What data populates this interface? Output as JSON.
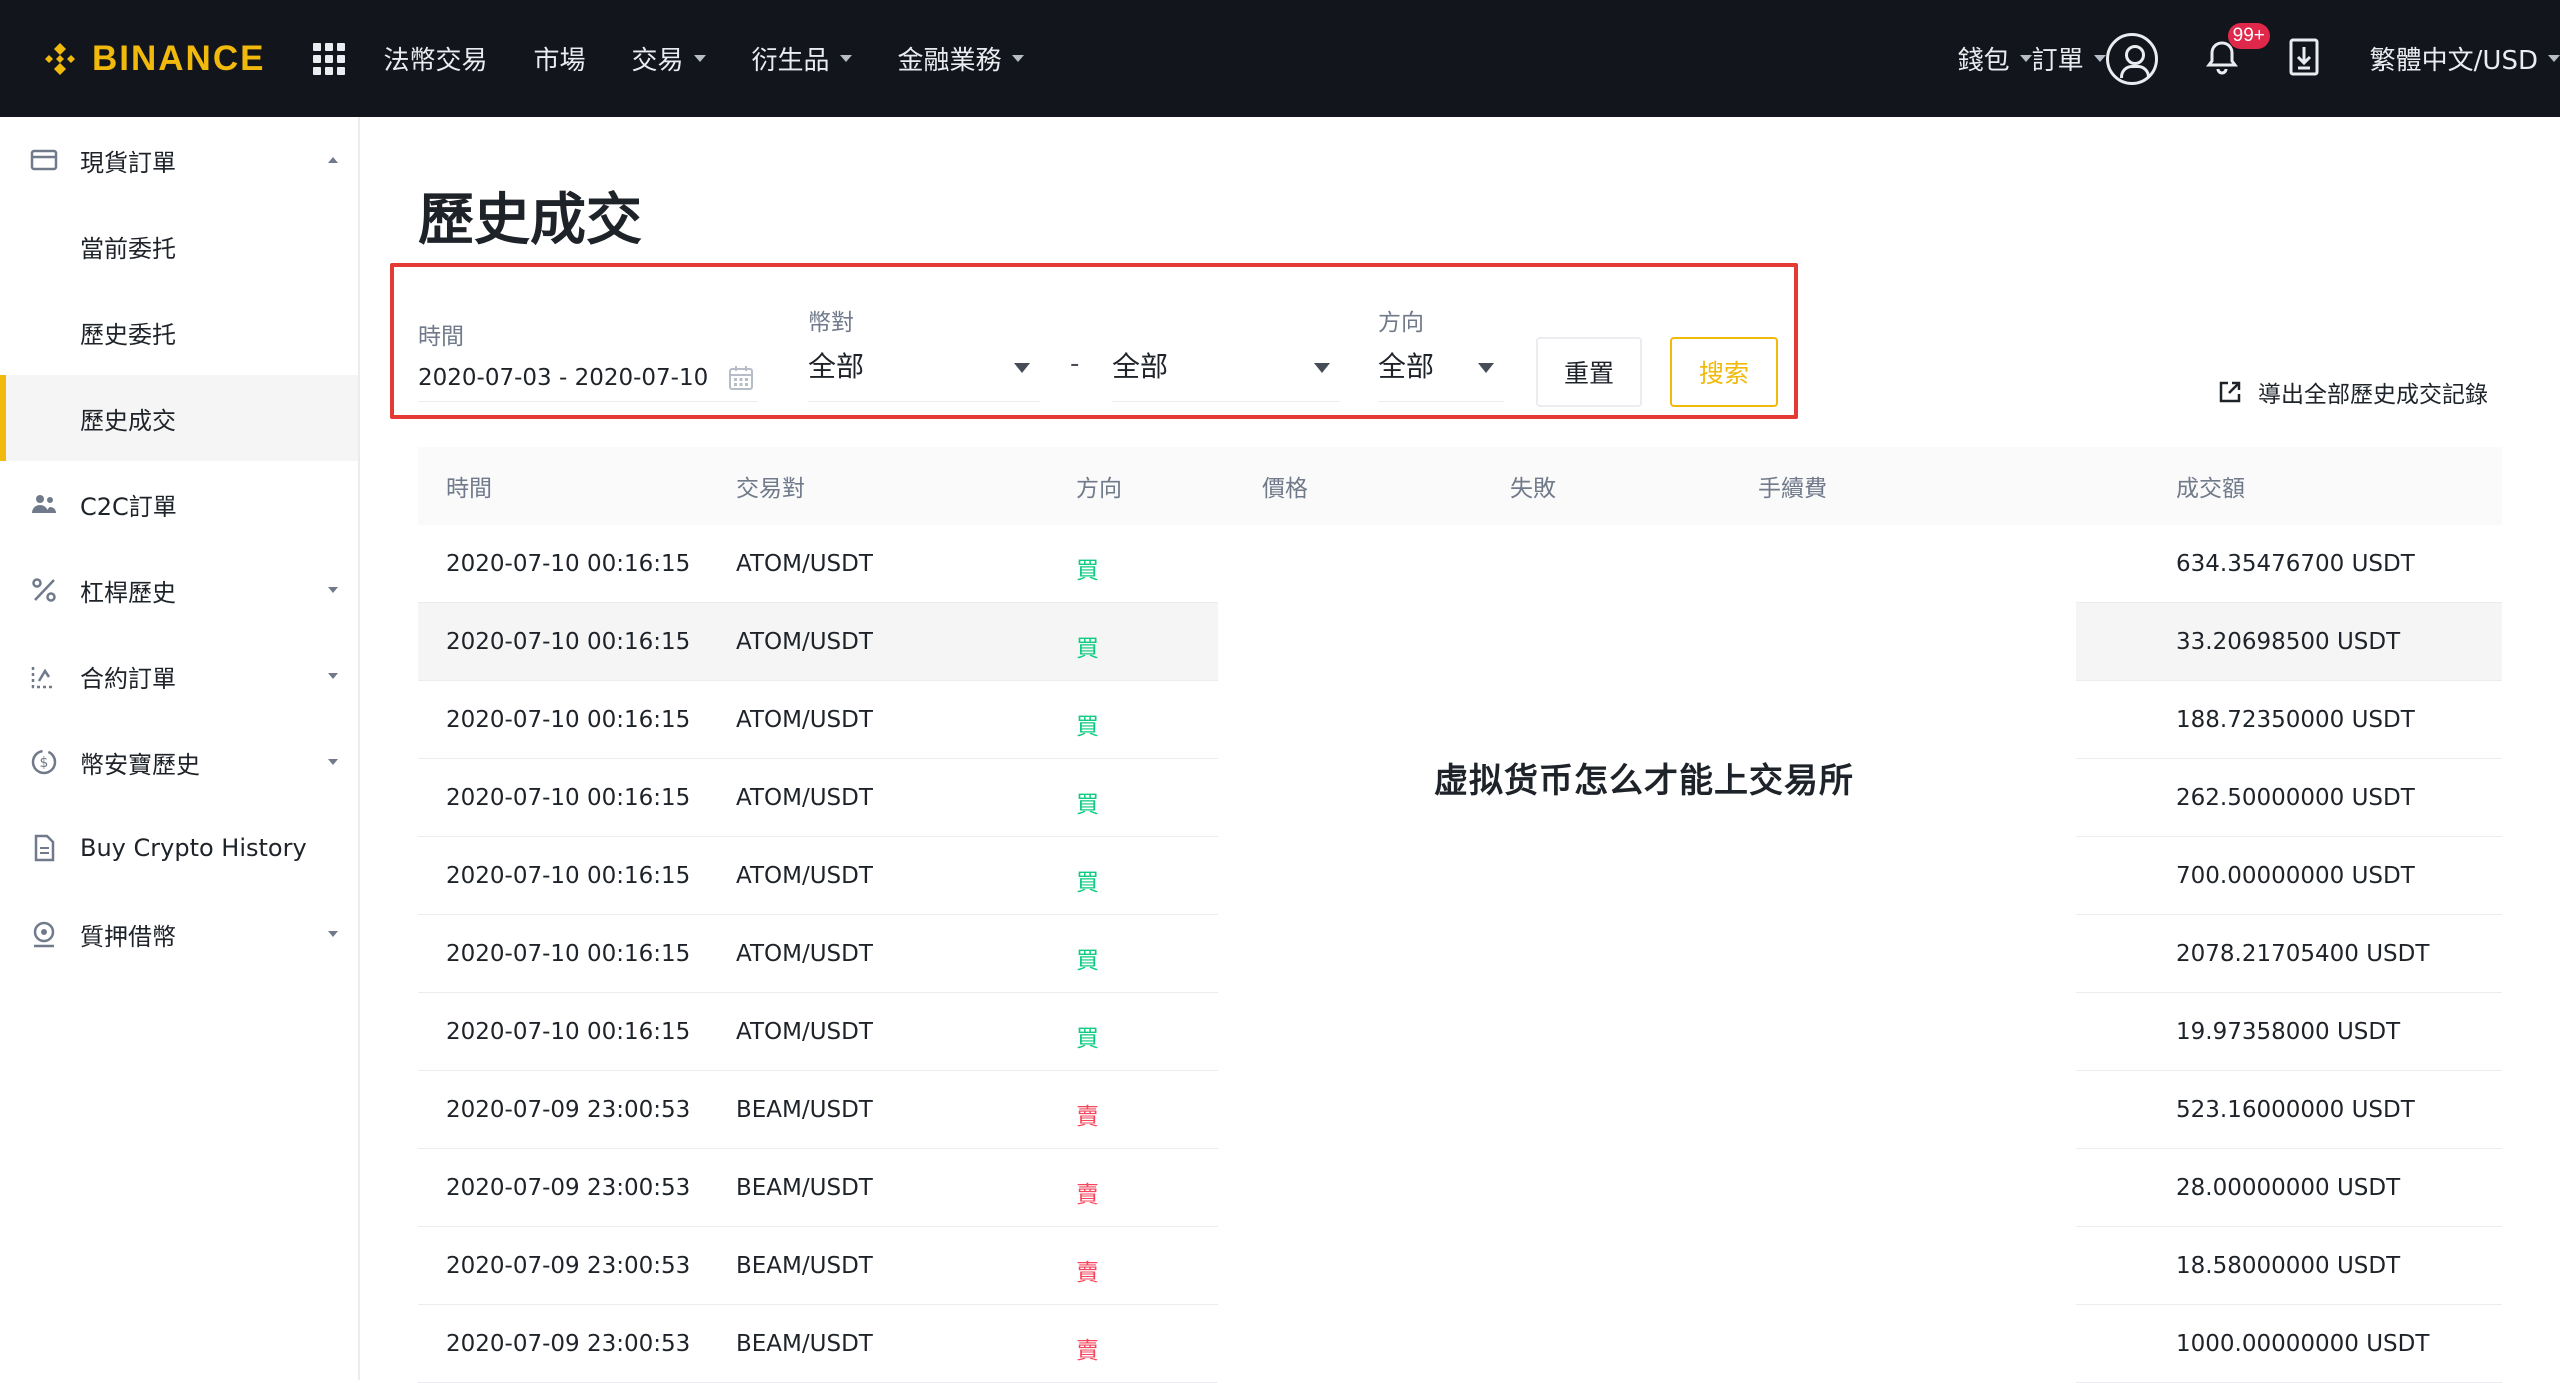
{
  "brand": {
    "name": "BINANCE",
    "color": "#f0b90b"
  },
  "nav": {
    "items": [
      {
        "label": "法幣交易",
        "dropdown": false
      },
      {
        "label": "市場",
        "dropdown": false
      },
      {
        "label": "交易",
        "dropdown": true
      },
      {
        "label": "衍生品",
        "dropdown": true
      },
      {
        "label": "金融業務",
        "dropdown": true
      }
    ],
    "wallet": "錢包",
    "orders": "訂單",
    "notification_badge": "99+",
    "language": "繁體中文/USD"
  },
  "sidebar": {
    "items": [
      {
        "label": "現貨訂單",
        "icon": "wallet-card-icon",
        "caret": "up"
      },
      {
        "label": "當前委托",
        "sub": true
      },
      {
        "label": "歷史委托",
        "sub": true
      },
      {
        "label": "歷史成交",
        "sub": true,
        "active": true
      },
      {
        "label": "C2C訂單",
        "icon": "users-icon"
      },
      {
        "label": "杠桿歷史",
        "icon": "percent-icon",
        "caret": "down"
      },
      {
        "label": "合約訂單",
        "icon": "futures-icon",
        "caret": "down"
      },
      {
        "label": "幣安寶歷史",
        "icon": "coin-icon",
        "caret": "down"
      },
      {
        "label": "Buy Crypto History",
        "icon": "document-icon"
      },
      {
        "label": "質押借幣",
        "icon": "loan-icon",
        "caret": "down"
      }
    ]
  },
  "page": {
    "title": "歷史成交",
    "export_label": "導出全部歷史成交記錄",
    "watermark": "虚拟货币怎么才能上交易所"
  },
  "filters": {
    "time_label": "時間",
    "time_value": "2020-07-03 - 2020-07-10",
    "pair_label": "幣對",
    "pair_base": "全部",
    "pair_separator": "-",
    "pair_quote": "全部",
    "side_label": "方向",
    "side_value": "全部",
    "reset_label": "重置",
    "search_label": "搜索"
  },
  "table": {
    "columns": [
      "時間",
      "交易對",
      "方向",
      "價格",
      "失敗",
      "手續費",
      "成交額"
    ],
    "rows": [
      {
        "time": "2020-07-10 00:16:15",
        "pair": "ATOM/USDT",
        "side": "買",
        "side_type": "buy",
        "amount": "634.35476700 USDT"
      },
      {
        "time": "2020-07-10 00:16:15",
        "pair": "ATOM/USDT",
        "side": "買",
        "side_type": "buy",
        "amount": "33.20698500 USDT"
      },
      {
        "time": "2020-07-10 00:16:15",
        "pair": "ATOM/USDT",
        "side": "買",
        "side_type": "buy",
        "amount": "188.72350000 USDT"
      },
      {
        "time": "2020-07-10 00:16:15",
        "pair": "ATOM/USDT",
        "side": "買",
        "side_type": "buy",
        "amount": "262.50000000 USDT"
      },
      {
        "time": "2020-07-10 00:16:15",
        "pair": "ATOM/USDT",
        "side": "買",
        "side_type": "buy",
        "amount": "700.00000000 USDT"
      },
      {
        "time": "2020-07-10 00:16:15",
        "pair": "ATOM/USDT",
        "side": "買",
        "side_type": "buy",
        "amount": "2078.21705400 USDT"
      },
      {
        "time": "2020-07-10 00:16:15",
        "pair": "ATOM/USDT",
        "side": "買",
        "side_type": "buy",
        "amount": "19.97358000 USDT"
      },
      {
        "time": "2020-07-09 23:00:53",
        "pair": "BEAM/USDT",
        "side": "賣",
        "side_type": "sell",
        "amount": "523.16000000 USDT"
      },
      {
        "time": "2020-07-09 23:00:53",
        "pair": "BEAM/USDT",
        "side": "賣",
        "side_type": "sell",
        "amount": "28.00000000 USDT"
      },
      {
        "time": "2020-07-09 23:00:53",
        "pair": "BEAM/USDT",
        "side": "賣",
        "side_type": "sell",
        "amount": "18.58000000 USDT"
      },
      {
        "time": "2020-07-09 23:00:53",
        "pair": "BEAM/USDT",
        "side": "賣",
        "side_type": "sell",
        "amount": "1000.00000000 USDT"
      }
    ]
  },
  "colors": {
    "buy": "#0ecb81",
    "sell": "#f6465d",
    "accent": "#f0b90b",
    "highlight_box": "#e53935"
  }
}
